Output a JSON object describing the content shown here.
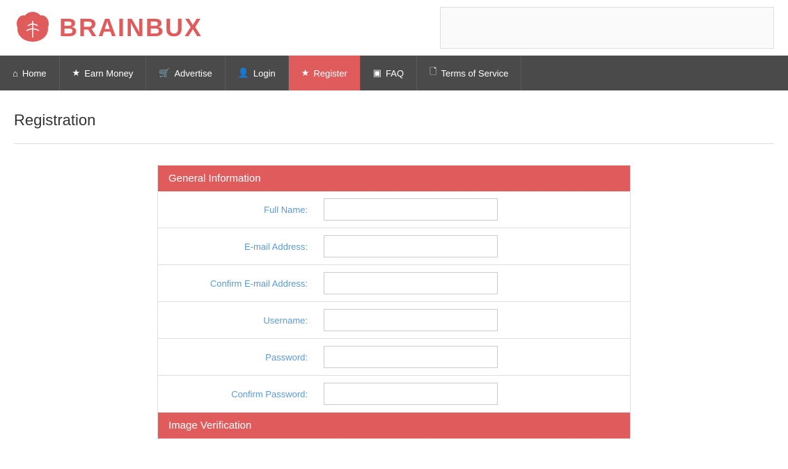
{
  "header": {
    "logo_text": "BRAINBUX"
  },
  "navbar": {
    "items": [
      {
        "id": "home",
        "icon": "⌂",
        "label": "Home",
        "active": false
      },
      {
        "id": "earn-money",
        "icon": "★",
        "label": "Earn Money",
        "active": false
      },
      {
        "id": "advertise",
        "icon": "🛒",
        "label": "Advertise",
        "active": false
      },
      {
        "id": "login",
        "icon": "👤",
        "label": "Login",
        "active": false
      },
      {
        "id": "register",
        "icon": "★",
        "label": "Register",
        "active": true
      },
      {
        "id": "faq",
        "icon": "▣",
        "label": "FAQ",
        "active": false
      },
      {
        "id": "terms",
        "icon": "🗋",
        "label": "Terms of Service",
        "active": false
      }
    ]
  },
  "page": {
    "title": "Registration"
  },
  "form": {
    "general_info_header": "General Information",
    "image_verification_header": "Image Verification",
    "fields": [
      {
        "id": "full-name",
        "label": "Full Name:",
        "type": "text",
        "placeholder": ""
      },
      {
        "id": "email",
        "label": "E-mail Address:",
        "type": "email",
        "placeholder": ""
      },
      {
        "id": "confirm-email",
        "label": "Confirm E-mail Address:",
        "type": "email",
        "placeholder": ""
      },
      {
        "id": "username",
        "label": "Username:",
        "type": "text",
        "placeholder": ""
      },
      {
        "id": "password",
        "label": "Password:",
        "type": "password",
        "placeholder": ""
      },
      {
        "id": "confirm-password",
        "label": "Confirm Password:",
        "type": "password",
        "placeholder": ""
      }
    ]
  },
  "colors": {
    "accent": "#e05c5c",
    "nav_bg": "#4a4a4a",
    "label_color": "#5b9bd5"
  }
}
